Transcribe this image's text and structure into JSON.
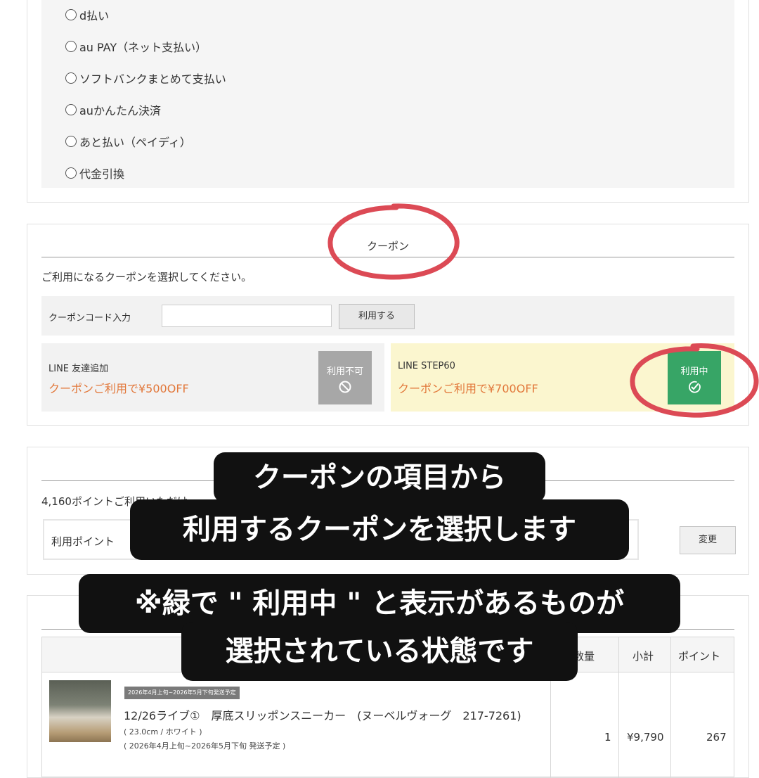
{
  "payment": {
    "options": [
      "d払い",
      "au PAY（ネット支払い）",
      "ソフトバンクまとめて支払い",
      "auかんたん決済",
      "あと払い（ペイディ）",
      "代金引換"
    ]
  },
  "coupon": {
    "title": "クーポン",
    "description": "ご利用になるクーポンを選択してください。",
    "code_label": "クーポンコード入力",
    "code_value": "",
    "code_button": "利用する",
    "items": [
      {
        "name": "LINE 友達追加",
        "offer": "クーポンご利用で¥500OFF",
        "status": "利用不可",
        "icon": "prohibited-icon"
      },
      {
        "name": "LINE STEP60",
        "offer": "クーポンご利用で¥700OFF",
        "status": "利用中",
        "icon": "check-circle-icon"
      }
    ],
    "offer_color": "#e2783b",
    "in_use_color": "#37a566"
  },
  "points": {
    "description": "4,160ポイントご利用いただけ",
    "field_label": "利用ポイント",
    "change_button": "変更"
  },
  "cart": {
    "headers": {
      "qty": "数量",
      "subtotal": "小計",
      "points": "ポイント"
    },
    "item": {
      "shipping_badge": "2026年4月上旬~2026年5月下旬発送予定",
      "name": "12/26ライブ①　厚底スリッポンスニーカー　(ヌーベルヴォーグ　217-7261)",
      "variant": "( 23.0cm / ホワイト )",
      "schedule": "( 2026年4月上旬~2026年5月下旬 発送予定 )",
      "qty": "1",
      "subtotal": "¥9,790",
      "points": "267"
    }
  },
  "overlay": {
    "caption1_line1": "クーポンの項目から",
    "caption1_line2": "利用するクーポンを選択します",
    "caption2_line1": "※緑で \" 利用中 \" と表示があるものが",
    "caption2_line2": "選択されている状態です",
    "highlight_color": "#dc4a55"
  }
}
